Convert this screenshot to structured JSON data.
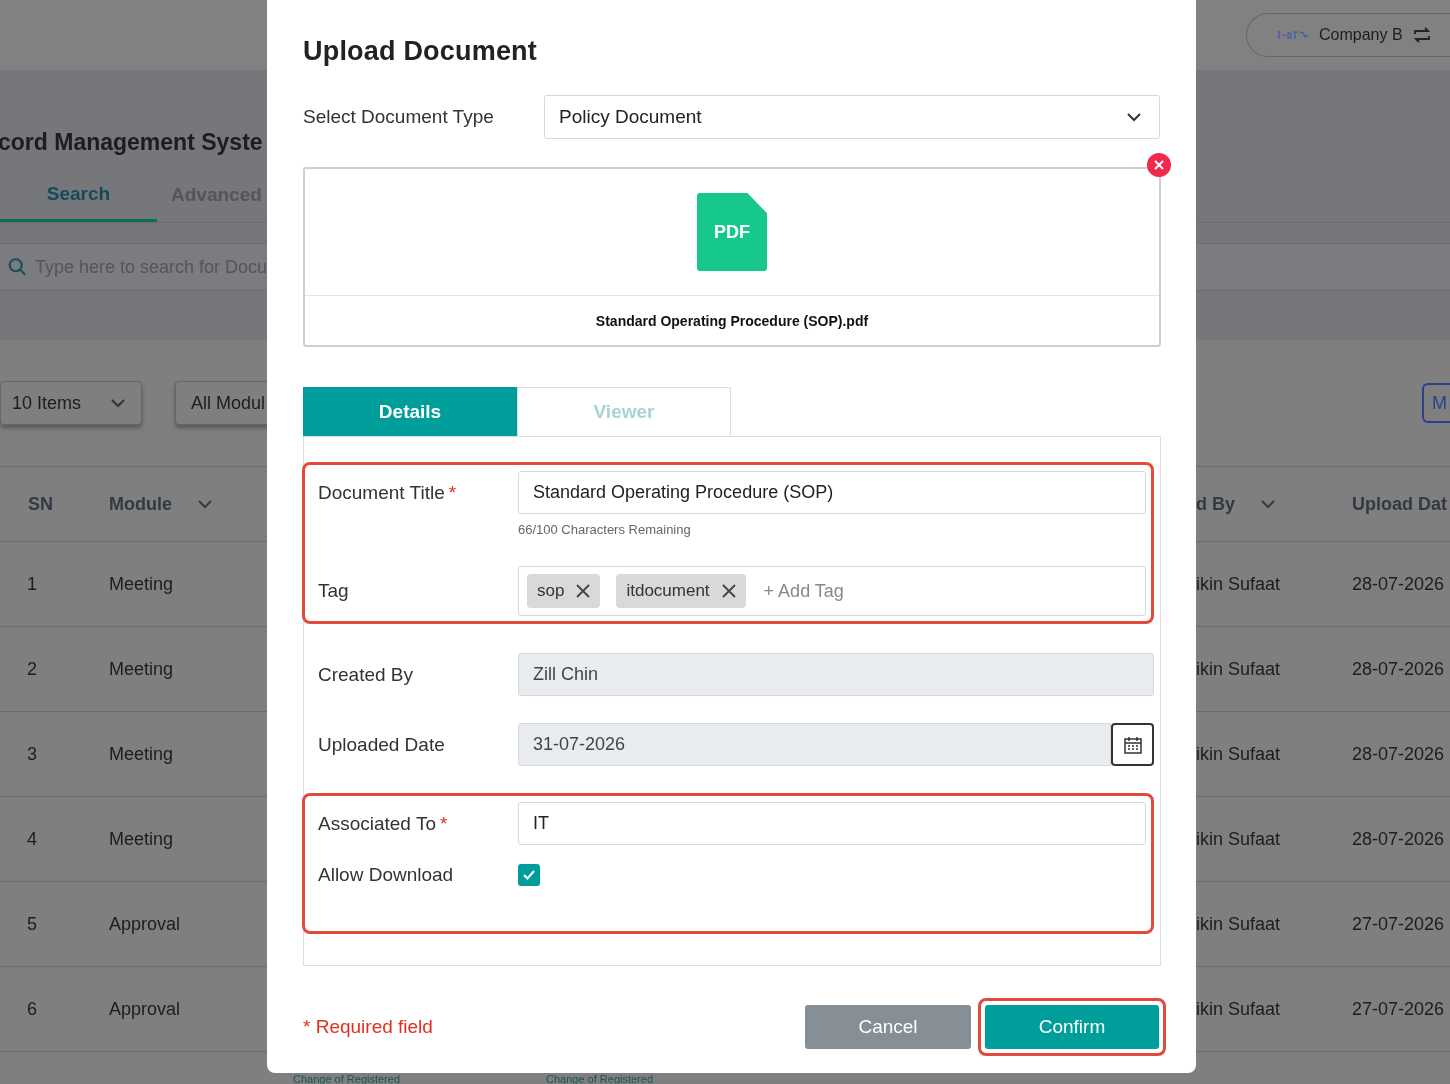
{
  "background": {
    "company": "Company B",
    "title": "cord Management Syste",
    "tabs": [
      {
        "label": "Search",
        "selected": true
      },
      {
        "label": "Advanced",
        "selected": false
      }
    ],
    "search": {
      "placeholder": "Type here to search for Docu"
    },
    "filters": [
      "10 Items",
      "All Modul"
    ],
    "side_button": "M",
    "columns": [
      {
        "label": "SN",
        "sortable": false
      },
      {
        "label": "Module",
        "sortable": true
      },
      {
        "label": "d By",
        "sortable": true
      },
      {
        "label": "Upload Dat",
        "sortable": false
      }
    ],
    "rows": [
      {
        "sn": "1",
        "module": "Meeting",
        "by": "ikin Sufaat",
        "date": "28-07-2026"
      },
      {
        "sn": "2",
        "module": "Meeting",
        "by": "ikin Sufaat",
        "date": "28-07-2026"
      },
      {
        "sn": "3",
        "module": "Meeting",
        "by": "ikin Sufaat",
        "date": "28-07-2026"
      },
      {
        "sn": "4",
        "module": "Meeting",
        "by": "ikin Sufaat",
        "date": "28-07-2026"
      },
      {
        "sn": "5",
        "module": "Approval",
        "by": "ikin Sufaat",
        "date": "27-07-2026"
      },
      {
        "sn": "6",
        "module": "Approval",
        "by": "ikin Sufaat",
        "date": "27-07-2026"
      }
    ],
    "partial_row": [
      "Change of Registered",
      "Change of Registered"
    ]
  },
  "dialog": {
    "title": "Upload Document",
    "doc_type": {
      "label": "Select Document Type",
      "value": "Policy Document"
    },
    "file": {
      "type_label": "PDF",
      "name": "Standard Operating Procedure (SOP).pdf"
    },
    "tabs": [
      {
        "label": "Details",
        "selected": true
      },
      {
        "label": "Viewer",
        "selected": false
      }
    ],
    "field_groups": [
      {
        "highlighted": true,
        "fields": [
          {
            "kind": "text",
            "label": "Document Title",
            "required_mark": "*",
            "value": "Standard Operating Procedure (SOP)",
            "helper": "66/100 Characters Remaining"
          },
          {
            "kind": "tags",
            "label": "Tag",
            "tags": [
              "sop",
              "itdocument"
            ],
            "placeholder": "+ Add Tag"
          }
        ]
      },
      {
        "highlighted": false,
        "fields": [
          {
            "kind": "readonly",
            "label": "Created By",
            "value": "Zill Chin"
          },
          {
            "kind": "date",
            "label": "Uploaded Date",
            "value": "31-07-2026"
          }
        ]
      },
      {
        "highlighted": true,
        "fields": [
          {
            "kind": "text",
            "label": "Associated To",
            "required_mark": "*",
            "value": "IT"
          },
          {
            "kind": "checkbox",
            "label": "Allow Download",
            "checked": true
          }
        ]
      }
    ],
    "required_note": "* Required field",
    "buttons": [
      {
        "label": "Cancel",
        "kind": "secondary",
        "highlighted": false
      },
      {
        "label": "Confirm",
        "kind": "primary",
        "highlighted": true
      }
    ]
  }
}
